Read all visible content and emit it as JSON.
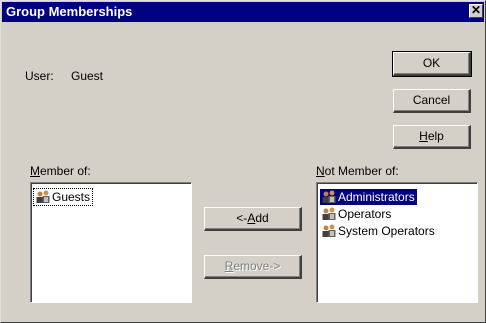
{
  "window": {
    "title": "Group Memberships",
    "close_glyph": "✕"
  },
  "user": {
    "label": "User:",
    "value": "Guest"
  },
  "buttons": {
    "ok": "OK",
    "cancel": "Cancel",
    "help_prefix": "",
    "help_mnemonic": "H",
    "help_rest": "elp",
    "add_prefix": "<-",
    "add_mnemonic": "A",
    "add_rest": "dd",
    "remove_mnemonic": "R",
    "remove_rest": "emove->"
  },
  "member_of": {
    "label_mnemonic": "M",
    "label_rest": "ember of:",
    "items": [
      {
        "label": "Guests",
        "icon": "group-icon"
      }
    ]
  },
  "not_member_of": {
    "label_mnemonic": "N",
    "label_rest": "ot Member of:",
    "items": [
      {
        "label": "Administrators",
        "icon": "group-icon",
        "selected": true
      },
      {
        "label": "Operators",
        "icon": "group-icon"
      },
      {
        "label": "System Operators",
        "icon": "group-icon"
      }
    ]
  },
  "colors": {
    "titlebar": "#000080",
    "face": "#d4d0c8",
    "selection": "#000080"
  }
}
